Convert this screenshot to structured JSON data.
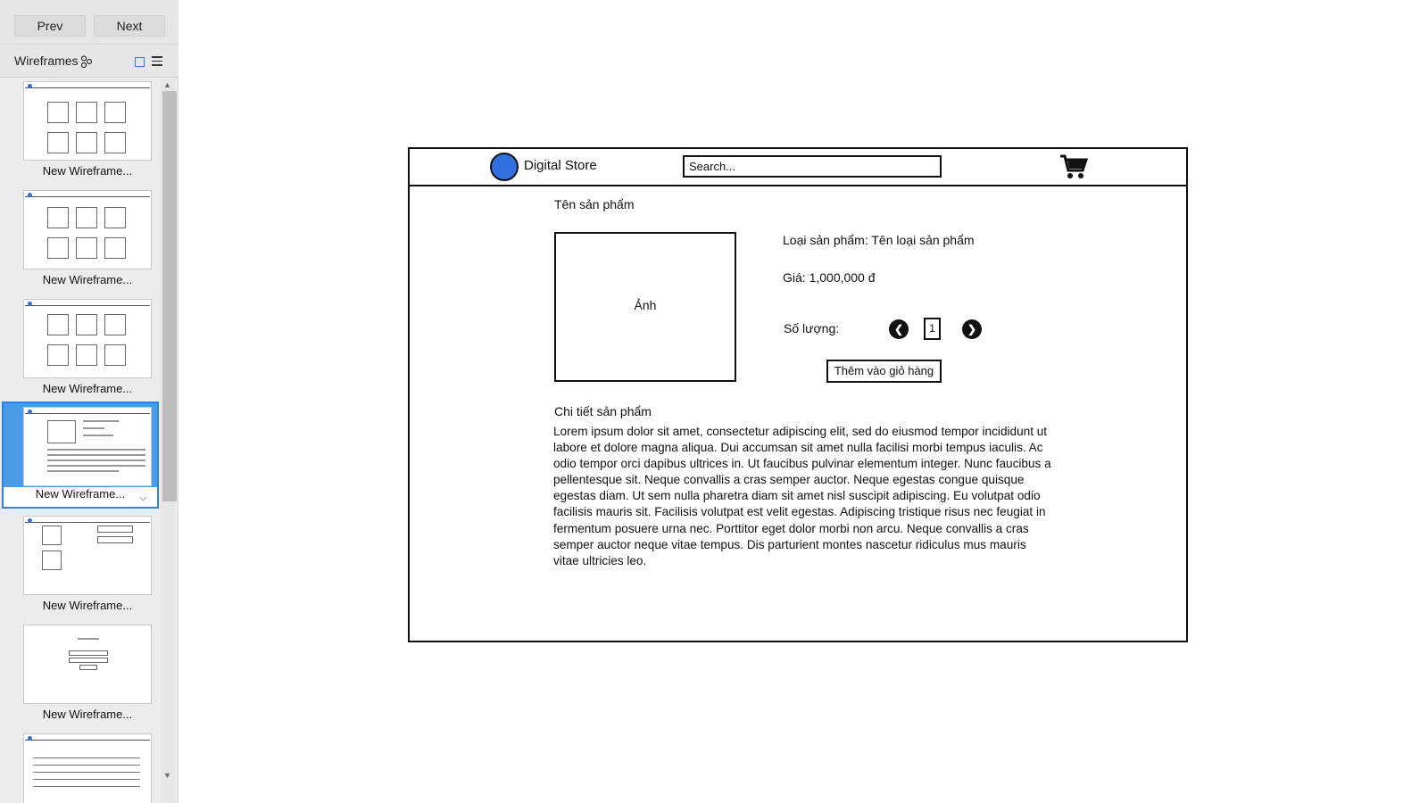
{
  "nav": {
    "prev_label": "Prev",
    "next_label": "Next"
  },
  "panel": {
    "title": "Wireframes"
  },
  "thumbnails": [
    {
      "label": "New Wireframe..."
    },
    {
      "label": "New Wireframe..."
    },
    {
      "label": "New Wireframe..."
    },
    {
      "label": "New Wireframe...",
      "selected": true
    },
    {
      "label": "New Wireframe..."
    },
    {
      "label": "New Wireframe..."
    },
    {
      "label": ""
    }
  ],
  "wireframe": {
    "store_name": "Digital Store",
    "search_placeholder": "Search...",
    "product_name": "Tên sản phẩm",
    "image_label": "Ảnh",
    "category": "Loại sản phẩm: Tên loại sản phẩm",
    "price": "Giá: 1,000,000 đ",
    "quantity_label": "Số lượng:",
    "quantity_value": "1",
    "add_to_cart_label": "Thêm vào giỏ hàng",
    "detail_heading": "Chi tiết sản phẩm",
    "detail_text": "Lorem ipsum dolor sit amet, consectetur adipiscing elit, sed do eiusmod tempor incididunt ut labore et dolore magna aliqua. Dui accumsan sit amet nulla facilisi morbi tempus iaculis. Ac odio tempor orci dapibus ultrices in. Ut faucibus pulvinar elementum integer. Nunc faucibus a pellentesque sit. Neque convallis a cras semper auctor. Neque egestas congue quisque egestas diam. Ut sem nulla pharetra diam sit amet nisl suscipit adipiscing. Eu volutpat odio facilisis mauris sit. Facilisis volutpat est velit egestas. Adipiscing tristique risus nec feugiat in fermentum posuere urna nec. Porttitor eget dolor morbi non arcu. Neque convallis a cras semper auctor neque vitae tempus. Dis parturient montes nascetur ridiculus mus mauris vitae ultricies leo."
  },
  "colors": {
    "accent": "#2f6fe0",
    "selection": "#4a9ce6"
  },
  "icons": [
    "link-icon",
    "grid-view-icon",
    "list-view-icon",
    "cart-icon",
    "chevron-left-icon",
    "chevron-right-icon",
    "chevron-down-icon"
  ]
}
